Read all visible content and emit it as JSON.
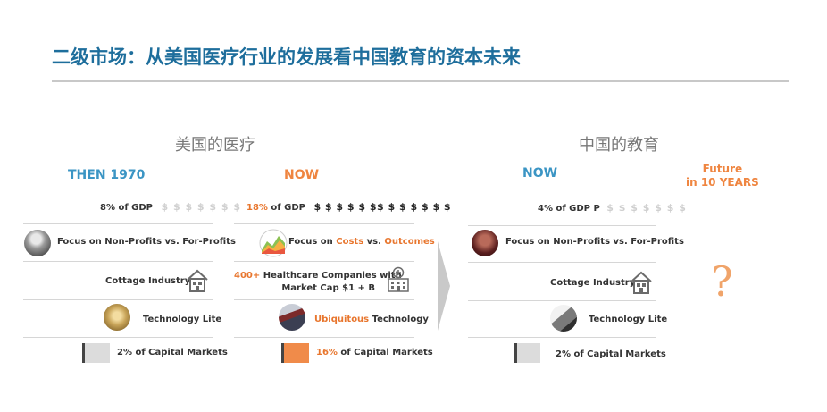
{
  "title": "二级市场：从美国医疗行业的发展看中国教育的资本未来",
  "left_section": {
    "heading": "美国的医疗",
    "then_label": "THEN 1970",
    "now_label": "NOW",
    "then": {
      "gdp_text": "8% of GDP",
      "gdp_dollars": "$ $ $ $ $ $ $",
      "focus_text": "Focus on Non-Profits vs. For-Profits",
      "industry_text": "Cottage Industry",
      "tech_text": "Technology Lite",
      "capital_text": "2% of Capital Markets"
    },
    "now": {
      "gdp_pct": "18%",
      "gdp_suffix": " of GDP",
      "gdp_dollars": "$ $ $ $ $ $$ $ $ $ $ $ $",
      "focus_prefix": "Focus on ",
      "focus_costs": "Costs",
      "focus_vs": " vs. ",
      "focus_outcomes": "Outcomes",
      "companies_pct": "400+",
      "companies_line1": " Healthcare Companies with",
      "companies_line2": "Market Cap $1 + B",
      "tech_hl": "Ubiquitous",
      "tech_rest": " Technology",
      "capital_pct": "16%",
      "capital_rest": " of Capital Markets"
    }
  },
  "right_section": {
    "heading": "中国的教育",
    "now_label": "NOW",
    "future_line1": "Future",
    "future_line2": "in 10 YEARS",
    "question": "?",
    "now": {
      "gdp_text": "4% of GDP P",
      "gdp_dollars": "$ $ $ $ $ $ $",
      "focus_text": "Focus on Non-Profits vs. For-Profits",
      "industry_text": "Cottage Industry",
      "tech_text": "Technology Lite",
      "capital_text": "2% of Capital Markets"
    }
  },
  "capital_bars": {
    "then_fraction": 0.02,
    "now_fraction": 0.16,
    "china_fraction": 0.02
  },
  "colors": {
    "title": "#1e6e9c",
    "blue": "#3b95c4",
    "orange": "#ef8540"
  },
  "icons": [
    "house-icon",
    "hospital-icon",
    "chevron-right-icon",
    "portrait-photo",
    "chart-icon",
    "laptop-photo"
  ]
}
